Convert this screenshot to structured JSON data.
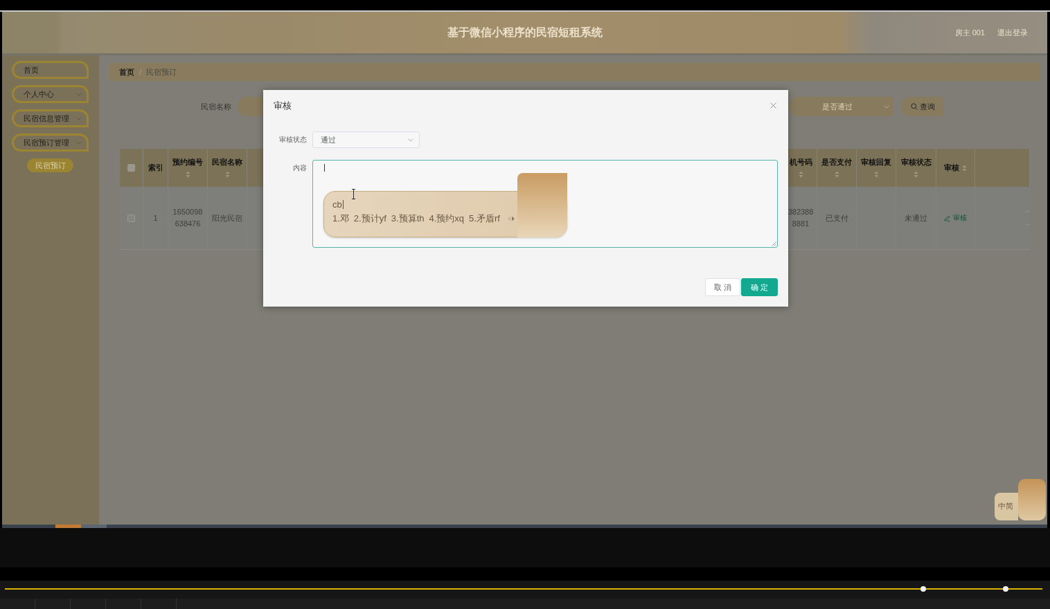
{
  "header": {
    "title": "基于微信小程序的民宿短租系统",
    "user": "房主 001",
    "logout": "退出登录"
  },
  "sidebar": {
    "items": [
      {
        "label": "首页",
        "kind": "link",
        "selected": false
      },
      {
        "label": "个人中心",
        "kind": "menu",
        "selected": false
      },
      {
        "label": "民宿信息管理",
        "kind": "menu",
        "selected": false
      },
      {
        "label": "民宿预订管理",
        "kind": "menu",
        "selected": false,
        "children": [
          {
            "label": "民宿预订",
            "selected": true
          }
        ]
      }
    ]
  },
  "breadcrumb": [
    "首页",
    "民宿预订"
  ],
  "search": {
    "name_label": "民宿名称",
    "status_placeholder": "是否通过",
    "button": "查询"
  },
  "table": {
    "columns": [
      {
        "kind": "checkbox",
        "checked": false
      },
      {
        "kind": "text",
        "label": "索引",
        "sortable": false
      },
      {
        "kind": "text",
        "label": "预约编号",
        "sortable": true
      },
      {
        "kind": "text",
        "label": "民宿名称",
        "sortable": true
      },
      {
        "kind": "text",
        "label": "机号码",
        "sortable": true
      },
      {
        "kind": "text",
        "label": "是否支付",
        "sortable": true
      },
      {
        "kind": "text",
        "label": "审核回复",
        "sortable": true
      },
      {
        "kind": "text",
        "label": "审核状态",
        "sortable": true
      },
      {
        "kind": "text",
        "label": "审核",
        "sortable": true
      },
      {
        "kind": "actions"
      }
    ],
    "rows": [
      {
        "cells": [
          {
            "kind": "checkbox",
            "checked": false
          },
          {
            "kind": "text",
            "text": "1"
          },
          {
            "kind": "text",
            "text": "1650098638476"
          },
          {
            "kind": "text",
            "text": "阳光民宿"
          },
          {
            "kind": "text",
            "text": "3823888881"
          },
          {
            "kind": "text",
            "text": "已支付"
          },
          {
            "kind": "empty"
          },
          {
            "kind": "text",
            "text": "未通过"
          },
          {
            "kind": "link",
            "text": "审核"
          },
          {
            "kind": "button_edge"
          }
        ]
      }
    ]
  },
  "dialog": {
    "title": "审核",
    "fields": [
      {
        "kind": "select",
        "label": "审核状态",
        "value": "通过"
      },
      {
        "kind": "textarea",
        "label": "内容",
        "focused": true
      }
    ],
    "buttons": [
      {
        "label": "取消",
        "primary": false
      },
      {
        "label": "确定",
        "primary": true
      }
    ]
  },
  "ime_popup": {
    "composition": "cb",
    "candidates": [
      "1.邓",
      "2.预计yf",
      "3.预算th",
      "4.预约xq",
      "5.矛盾rf"
    ]
  },
  "ime_toolbar": {
    "label": "中简"
  },
  "taskbar": {
    "items": [
      {
        "selected": true
      },
      {
        "selected": false
      }
    ]
  }
}
